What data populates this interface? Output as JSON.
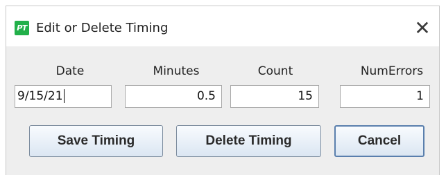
{
  "window": {
    "title": "Edit or Delete Timing",
    "app_icon_text": "PT",
    "close_glyph": "✕"
  },
  "form": {
    "date": {
      "label": "Date",
      "value": "9/15/21"
    },
    "minutes": {
      "label": "Minutes",
      "value": "0.5"
    },
    "count": {
      "label": "Count",
      "value": "15"
    },
    "num_errors": {
      "label": "NumErrors",
      "value": "1"
    }
  },
  "buttons": {
    "save": "Save Timing",
    "delete": "Delete Timing",
    "cancel": "Cancel"
  },
  "colors": {
    "app_icon": "#22b04a",
    "dialog_background": "#eeeeee",
    "button_border": "#7a8a9c"
  }
}
